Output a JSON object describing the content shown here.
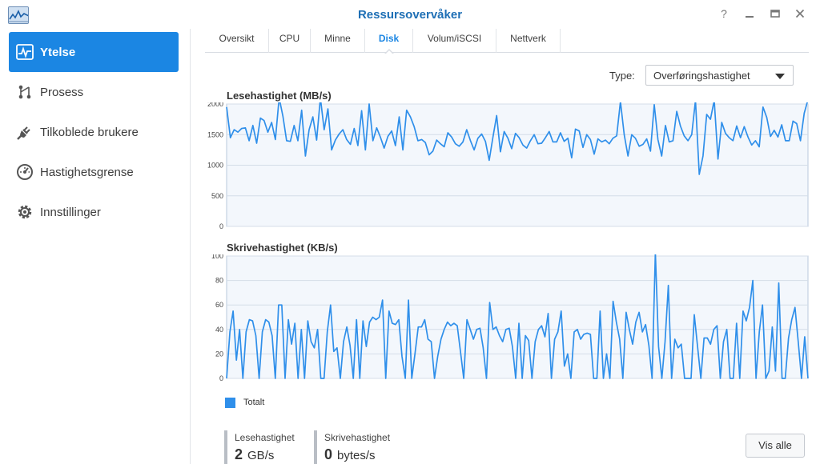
{
  "window": {
    "title": "Ressursovervåker",
    "app_icon": "resource-monitor-icon",
    "buttons": [
      "help-icon",
      "minimize-icon",
      "maximize-icon",
      "close-icon"
    ]
  },
  "sidebar": {
    "items": [
      {
        "label": "Ytelse",
        "icon": "performance-icon",
        "active": true
      },
      {
        "label": "Prosess",
        "icon": "process-icon",
        "active": false
      },
      {
        "label": "Tilkoblede brukere",
        "icon": "connected-users-icon",
        "active": false
      },
      {
        "label": "Hastighetsgrense",
        "icon": "speed-limit-icon",
        "active": false
      },
      {
        "label": "Innstillinger",
        "icon": "settings-icon",
        "active": false
      }
    ]
  },
  "tabs": [
    {
      "label": "Oversikt",
      "active": false
    },
    {
      "label": "CPU",
      "active": false
    },
    {
      "label": "Minne",
      "active": false
    },
    {
      "label": "Disk",
      "active": true
    },
    {
      "label": "Volum/iSCSI",
      "active": false
    },
    {
      "label": "Nettverk",
      "active": false
    }
  ],
  "type_selector": {
    "label": "Type:",
    "value": "Overføringshastighet"
  },
  "legend": {
    "label": "Totalt",
    "color": "#2f8fea"
  },
  "stats": {
    "read": {
      "label": "Lesehastighet",
      "value": "2",
      "unit": "GB/s"
    },
    "write": {
      "label": "Skrivehastighet",
      "value": "0",
      "unit": "bytes/s"
    }
  },
  "view_all_button": "Vis alle",
  "colors": {
    "accent": "#1b86e3",
    "series": "#2f8fea",
    "plot_bg": "#f3f7fc"
  },
  "chart_data": [
    {
      "type": "line",
      "title": "Lesehastighet (MB/s)",
      "ylim": [
        0,
        2000
      ],
      "yticks": [
        0,
        500,
        1000,
        1500,
        2000
      ],
      "grid": true,
      "series": [
        {
          "name": "Totalt",
          "values": [
            1950,
            1450,
            1580,
            1540,
            1600,
            1610,
            1400,
            1650,
            1360,
            1770,
            1730,
            1540,
            1700,
            1420,
            2100,
            1800,
            1400,
            1390,
            1650,
            1400,
            1900,
            1150,
            1580,
            1790,
            1410,
            2100,
            1580,
            1920,
            1250,
            1410,
            1510,
            1580,
            1420,
            1340,
            1600,
            1320,
            1890,
            1250,
            2000,
            1400,
            1610,
            1460,
            1280,
            1470,
            1560,
            1320,
            1790,
            1250,
            1900,
            1790,
            1630,
            1400,
            1420,
            1370,
            1170,
            1230,
            1410,
            1350,
            1300,
            1530,
            1460,
            1350,
            1310,
            1380,
            1580,
            1400,
            1250,
            1440,
            1510,
            1390,
            1080,
            1460,
            1810,
            1220,
            1550,
            1440,
            1270,
            1520,
            1450,
            1330,
            1280,
            1400,
            1500,
            1350,
            1360,
            1450,
            1550,
            1380,
            1380,
            1530,
            1390,
            1440,
            1120,
            1590,
            1560,
            1290,
            1500,
            1420,
            1180,
            1430,
            1380,
            1410,
            1350,
            1440,
            1480,
            2040,
            1500,
            1150,
            1500,
            1440,
            1310,
            1340,
            1430,
            1230,
            1990,
            1420,
            1150,
            1650,
            1380,
            1400,
            1880,
            1640,
            1480,
            1400,
            1500,
            2060,
            850,
            1150,
            1830,
            1750,
            2060,
            1100,
            1700,
            1520,
            1450,
            1400,
            1640,
            1450,
            1630,
            1460,
            1330,
            1400,
            1300,
            1950,
            1780,
            1470,
            1570,
            1460,
            1660,
            1400,
            1400,
            1720,
            1680,
            1400,
            1850,
            2070
          ]
        }
      ]
    },
    {
      "type": "line",
      "title": "Skrivehastighet (KB/s)",
      "ylim": [
        0,
        100
      ],
      "yticks": [
        0,
        20,
        40,
        60,
        80,
        100
      ],
      "grid": true,
      "series": [
        {
          "name": "Totalt",
          "values": [
            0,
            38,
            55,
            15,
            40,
            0,
            38,
            48,
            47,
            35,
            0,
            38,
            48,
            46,
            35,
            0,
            60,
            60,
            0,
            48,
            28,
            45,
            0,
            40,
            0,
            47,
            30,
            25,
            40,
            0,
            0,
            38,
            60,
            22,
            25,
            0,
            30,
            42,
            27,
            0,
            48,
            0,
            47,
            26,
            46,
            50,
            48,
            50,
            64,
            0,
            55,
            45,
            44,
            48,
            18,
            0,
            64,
            0,
            20,
            42,
            42,
            48,
            32,
            30,
            0,
            18,
            32,
            40,
            46,
            43,
            45,
            43,
            22,
            0,
            48,
            40,
            32,
            40,
            41,
            25,
            0,
            62,
            40,
            42,
            35,
            30,
            40,
            41,
            26,
            0,
            45,
            0,
            35,
            31,
            0,
            30,
            40,
            43,
            34,
            53,
            0,
            32,
            38,
            55,
            10,
            20,
            0,
            38,
            40,
            32,
            36,
            37,
            36,
            0,
            0,
            55,
            0,
            20,
            0,
            63,
            46,
            32,
            0,
            54,
            40,
            28,
            46,
            54,
            38,
            44,
            27,
            0,
            103,
            26,
            0,
            30,
            76,
            0,
            32,
            25,
            28,
            0,
            0,
            0,
            52,
            26,
            0,
            33,
            33,
            28,
            40,
            43,
            0,
            30,
            40,
            0,
            0,
            45,
            0,
            55,
            47,
            58,
            80,
            0,
            38,
            60,
            0,
            6,
            42,
            6,
            78,
            0,
            0,
            33,
            48,
            58,
            30,
            0,
            34,
            0
          ]
        }
      ]
    }
  ]
}
